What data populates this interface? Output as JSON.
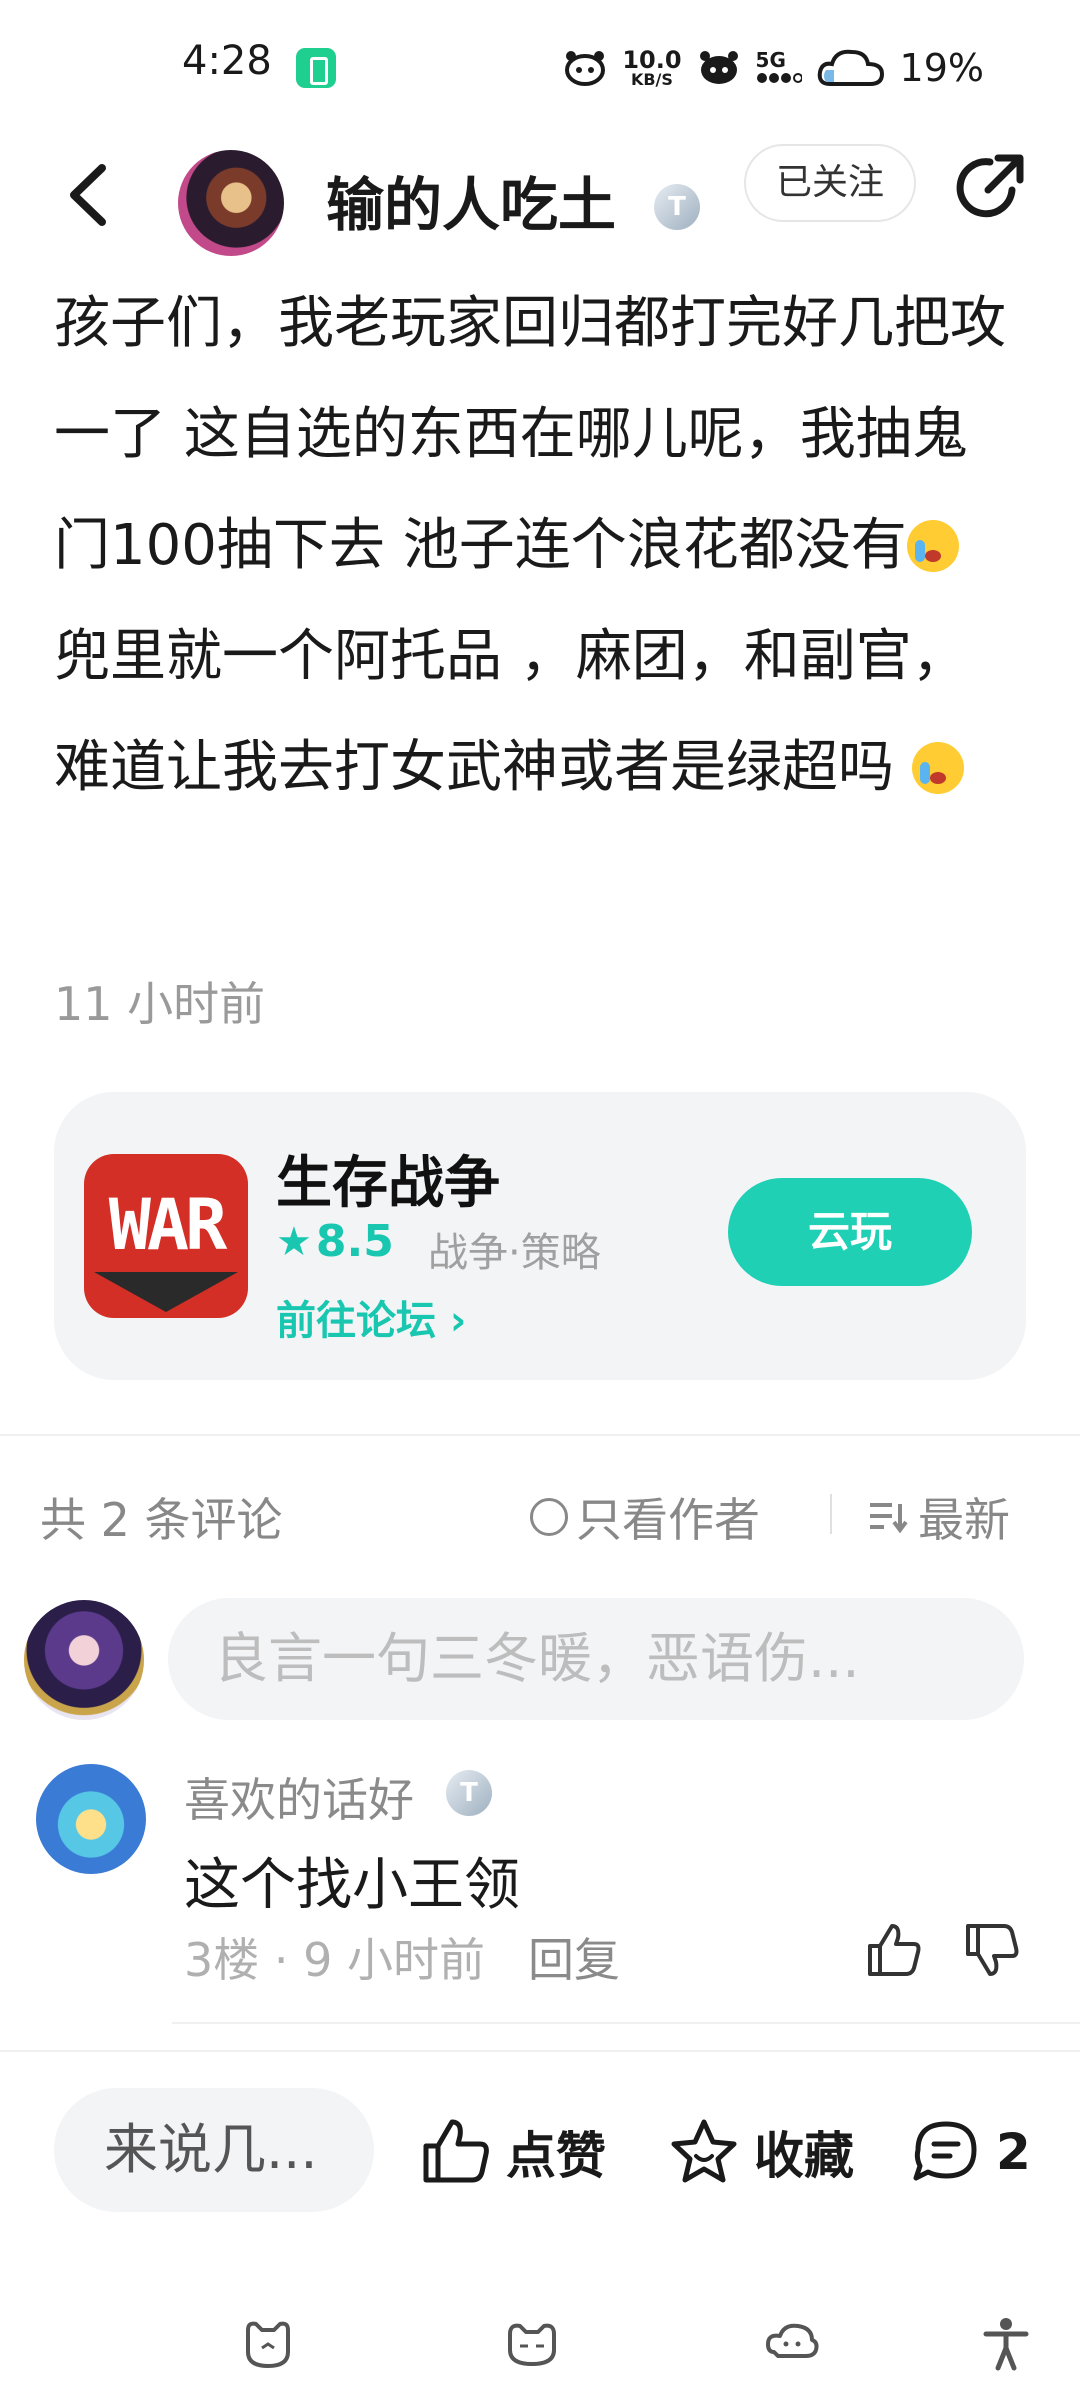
{
  "status_bar": {
    "time": "4:28",
    "net_speed_value": "10.0",
    "net_speed_unit": "KB/S",
    "network": "5G",
    "battery": "19%"
  },
  "header": {
    "author_name": "输的人吃土",
    "level_badge": "T",
    "follow_label": "已关注"
  },
  "post": {
    "text_part1": "孩子们，我老玩家回归都打完好几把攻一了 这自选的东西在哪儿呢，我抽鬼门100抽下去 池子连个浪花都没有",
    "text_part2": "兜里就一个阿托品 ，麻团，和副官，难道让我去打女武神或者是绿超吗 ",
    "time": "11 小时前"
  },
  "game_card": {
    "icon_text": "WAR",
    "title": "生存战争",
    "rating": "8.5",
    "tags": "战争·策略",
    "forum_link": "前往论坛",
    "cloud_play": "云玩"
  },
  "comments": {
    "count_label": "共 2 条评论",
    "author_only_label": "只看作者",
    "sort_label": "最新",
    "input_placeholder": "良言一句三冬暖，恶语伤...",
    "items": [
      {
        "user": "喜欢的话好",
        "badge": "T",
        "text": "这个找小王领",
        "meta": "3楼 · 9 小时前",
        "reply_label": "回复"
      }
    ]
  },
  "action_bar": {
    "say_placeholder": "来说几...",
    "like_label": "点赞",
    "fav_label": "收藏",
    "comment_count": "2"
  },
  "colors": {
    "accent": "#20d0b4",
    "text": "#1a1a1a",
    "muted": "#8a8a8a",
    "card_bg": "#f3f4f6"
  },
  "icons": [
    "back-arrow-icon",
    "share-icon",
    "star-icon",
    "sort-icon",
    "thumb-up-icon",
    "thumb-down-icon",
    "star-outline-icon",
    "chat-bubble-icon",
    "accessibility-icon"
  ]
}
